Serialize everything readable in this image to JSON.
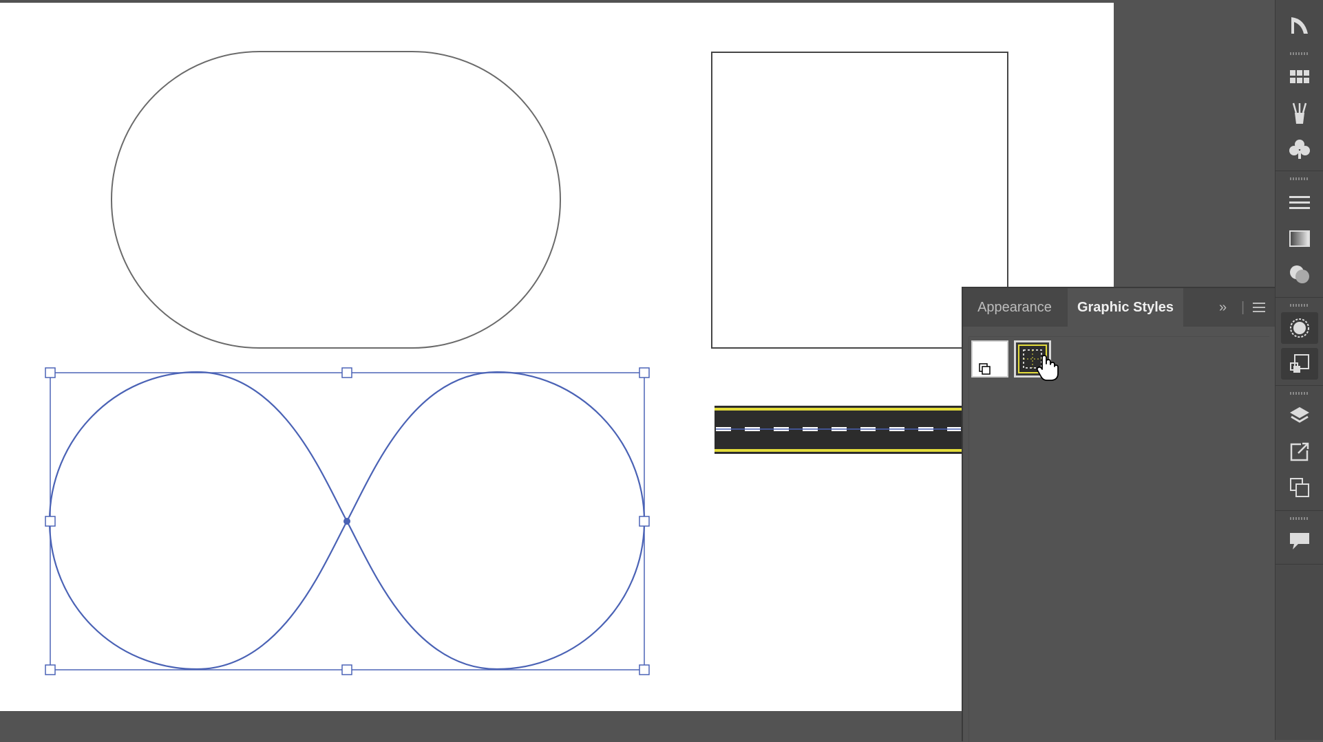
{
  "panel": {
    "tabs": [
      {
        "label": "Appearance",
        "active": false
      },
      {
        "label": "Graphic Styles",
        "active": true
      }
    ],
    "expand_icon": "double-chevron-right-icon",
    "menu_icon": "hamburger-menu-icon"
  },
  "graphic_styles": [
    {
      "name": "default-style",
      "selected": false
    },
    {
      "name": "road-style",
      "selected": true
    }
  ],
  "canvas": {
    "shapes": [
      "rounded-capsule",
      "square",
      "infinity-path",
      "road-stroke"
    ],
    "selected_shape": "infinity-path"
  },
  "colors": {
    "selection": "#4a62b5",
    "road_asphalt": "#2c2c2c",
    "road_edge": "#e3dc3a",
    "road_dash": "#ffffff",
    "ui_dark": "#535353"
  },
  "right_strip_icons": [
    "transform-icon",
    "swatches-icon",
    "brushes-icon",
    "symbols-icon",
    "stroke-icon",
    "gradient-icon",
    "transparency-icon",
    "appearance-icon",
    "graphic-styles-icon",
    "layers-icon",
    "export-icon",
    "artboards-icon",
    "comments-icon"
  ]
}
